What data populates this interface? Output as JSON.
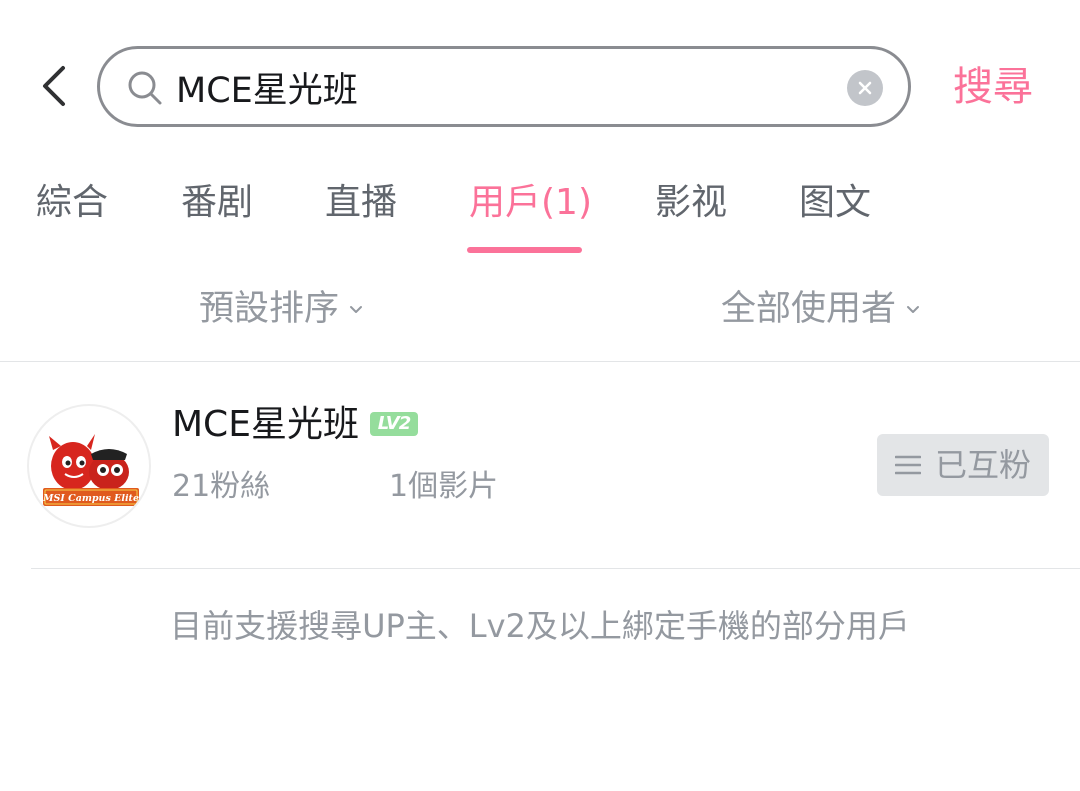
{
  "header": {
    "search_value": "MCE星光班",
    "search_button_label": "搜尋"
  },
  "tabs": [
    {
      "label": "綜合",
      "active": false
    },
    {
      "label": "番剧",
      "active": false
    },
    {
      "label": "直播",
      "active": false
    },
    {
      "label": "用戶(1)",
      "active": true
    },
    {
      "label": "影视",
      "active": false
    },
    {
      "label": "图文",
      "active": false
    }
  ],
  "filters": {
    "sort": "預設排序",
    "user_type": "全部使用者"
  },
  "result": {
    "name": "MCE星光班",
    "level": "LV2",
    "fans": "21粉絲",
    "videos": "1個影片",
    "follow_state": "已互粉",
    "avatar_caption": "MSI Campus Elite"
  },
  "note": "目前支援搜尋UP主、Lv2及以上綁定手機的部分用戶",
  "colors": {
    "accent": "#fb7299",
    "level_badge": "#95dd9c",
    "muted_text": "#9499a0",
    "primary_text": "#18191c"
  },
  "icons": {
    "back": "chevron-left-icon",
    "search": "search-icon",
    "clear": "close-icon",
    "dropdown": "chevron-down-icon",
    "follow_menu": "menu-icon"
  }
}
